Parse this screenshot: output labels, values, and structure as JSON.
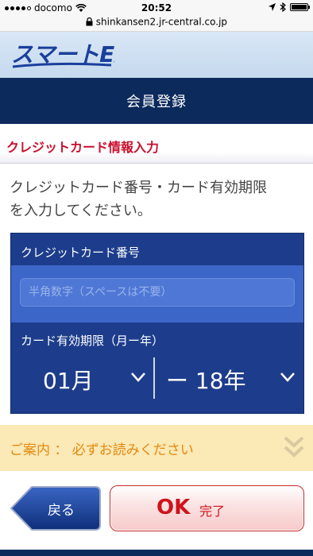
{
  "status_bar": {
    "carrier": "docomo",
    "time": "20:52"
  },
  "browser": {
    "url": "shinkansen2.jr-central.co.jp"
  },
  "logo": {
    "text": "スマートEX"
  },
  "header": {
    "title": "会員登録"
  },
  "section": {
    "heading": "クレジットカード情報入力"
  },
  "instruction": {
    "line1": "クレジットカード番号・カード有効期限",
    "line2": "を入力してください。"
  },
  "form": {
    "card_number_label": "クレジットカード番号",
    "card_number_placeholder": "半角数字（スペースは不要）",
    "card_number_value": "",
    "expiry_label": "カード有効期限（月ー年）",
    "month_value": "01月",
    "year_value": "ー 18年"
  },
  "notice": {
    "text": "ご案内 ： 必ずお読みください"
  },
  "buttons": {
    "back_label": "戻る",
    "ok_label": "OK",
    "done_label": "完了"
  },
  "colors": {
    "navy": "#0c2a5c",
    "panel_blue": "#1d3d8c",
    "heading_red": "#c8102e",
    "notice_bg": "#fbe9b6",
    "notice_text": "#e48a10"
  }
}
